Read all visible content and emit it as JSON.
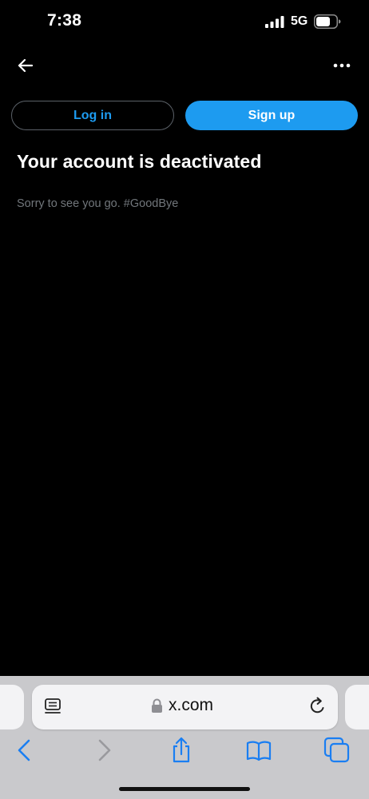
{
  "status_bar": {
    "time": "7:38",
    "network": "5G",
    "signal_icon": "cellular-signal-icon",
    "battery_icon": "battery-icon"
  },
  "nav": {
    "back_icon": "arrow-left-icon",
    "more_icon": "ellipsis-icon"
  },
  "buttons": {
    "login": "Log in",
    "signup": "Sign up"
  },
  "content": {
    "title": "Your account is deactivated",
    "message": "Sorry to see you go. #GoodBye"
  },
  "browser": {
    "url": "x.com",
    "toolbar_icons": [
      "back-icon",
      "forward-icon",
      "share-icon",
      "bookmarks-icon",
      "tabs-icon"
    ]
  },
  "colors": {
    "accent": "#1d9bf0",
    "background": "#000000",
    "muted_text": "#71767b",
    "safari_bar": "#c9c9cc",
    "safari_icon": "#1a7ef2"
  }
}
